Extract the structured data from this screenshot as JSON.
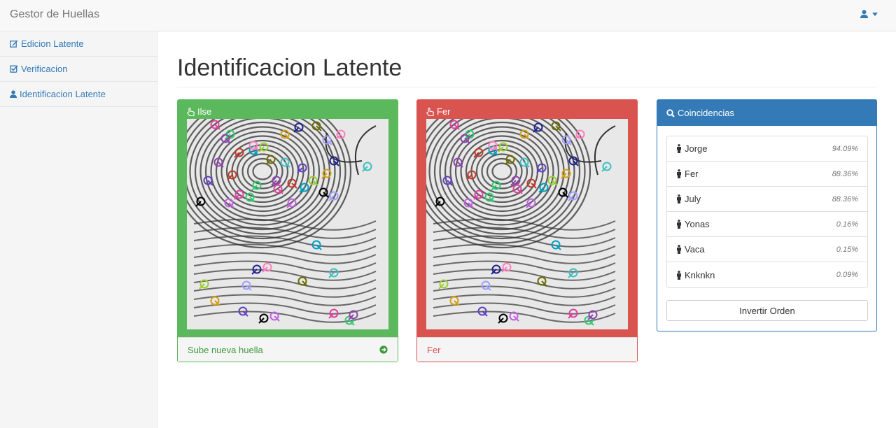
{
  "navbar": {
    "brand": "Gestor de Huellas",
    "user_icon": "user-icon"
  },
  "sidebar": {
    "items": [
      {
        "label": "Edicion Latente",
        "icon": "edit-icon"
      },
      {
        "label": "Verificacion",
        "icon": "check-square-icon"
      },
      {
        "label": "Identificacion Latente",
        "icon": "user-icon"
      }
    ]
  },
  "page": {
    "title": "Identificacion Latente"
  },
  "cards": [
    {
      "name": "Ilse",
      "icon": "hand-pointer-icon",
      "footer": "Sube nueva huella",
      "color": "#5cb85c"
    },
    {
      "name": "Fer",
      "icon": "hand-pointer-icon",
      "footer": "Fer",
      "color": "#d9534f"
    }
  ],
  "matches": {
    "title": "Coincidencias",
    "icon": "search-icon",
    "items": [
      {
        "name": "Jorge",
        "score": "94.09%"
      },
      {
        "name": "Fer",
        "score": "88.36%"
      },
      {
        "name": "July",
        "score": "88.36%"
      },
      {
        "name": "Yonas",
        "score": "0.16%"
      },
      {
        "name": "Vaca",
        "score": "0.15%"
      },
      {
        "name": "Knknkn",
        "score": "0.09%"
      }
    ],
    "button_label": "Invertir Orden"
  },
  "colors": {
    "primary": "#337ab7",
    "success": "#5cb85c",
    "danger": "#d9534f"
  }
}
